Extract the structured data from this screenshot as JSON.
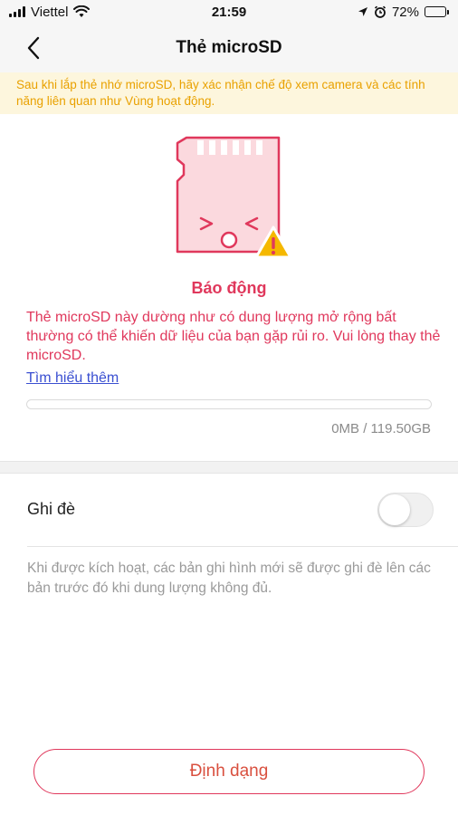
{
  "status_bar": {
    "carrier": "Viettel",
    "time": "21:59",
    "battery": "72%",
    "battery_level": 0.72
  },
  "nav": {
    "title": "Thẻ microSD"
  },
  "banner": {
    "text": "Sau khi lắp thẻ nhớ microSD, hãy xác nhận chế độ xem camera và các tính năng liên quan như Vùng hoạt động."
  },
  "alert": {
    "title": "Báo động",
    "message": "Thẻ microSD này dường như có dung lượng mở rộng bất thường có thể khiến dữ liệu của bạn gặp rủi ro. Vui lòng thay thẻ microSD.",
    "learn_more": "Tìm hiểu thêm"
  },
  "storage": {
    "used_fraction": 0,
    "text": "0MB / 119.50GB"
  },
  "overwrite": {
    "label": "Ghi đè",
    "enabled": false,
    "description": "Khi được kích hoạt, các bản ghi hình mới sẽ được ghi đè lên các bản trước đó khi dung lượng không đủ."
  },
  "format_button": {
    "label": "Định dạng"
  },
  "colors": {
    "accent": "#e0385c",
    "warning": "#f5b800",
    "banner_text": "#e9a100",
    "banner_bg": "#fdf6dd",
    "link": "#3a4fd1"
  },
  "icons": [
    "signal-icon",
    "wifi-icon",
    "location-arrow-icon",
    "alarm-icon",
    "battery-icon",
    "back-chevron-icon",
    "microsd-card-icon",
    "warning-triangle-icon"
  ]
}
